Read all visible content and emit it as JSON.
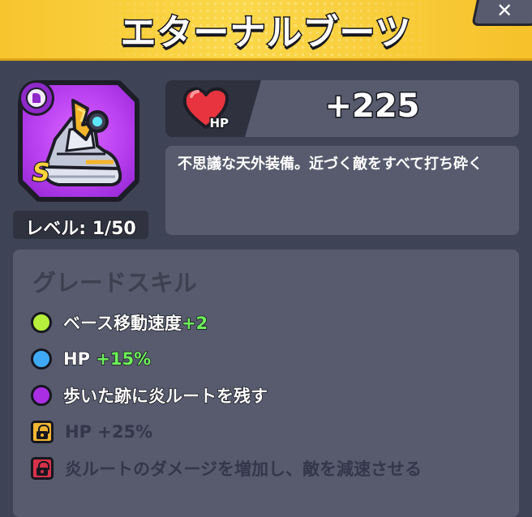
{
  "header": {
    "title": "エターナルブーツ",
    "close_icon": "close-x-icon"
  },
  "item": {
    "grade": "S",
    "rarity_icon": "boot-rarity-icon",
    "item_icon": "eternal-boots-icon",
    "frame_color": "#b93ff0",
    "level_label": "レベル: 1/50"
  },
  "stat": {
    "icon": "heart-hp-icon",
    "icon_label": "HP",
    "value": "+225"
  },
  "description": "不思議な天外装備。近づく敵をすべて打ち砕く",
  "skills": {
    "title": "グレードスキル",
    "items": [
      {
        "text": "ベース移動速度",
        "bonus": "+2",
        "dot": "green",
        "color": "#b6ef3c",
        "locked": false
      },
      {
        "text": "HP ",
        "bonus": "+15%",
        "dot": "blue",
        "color": "#3fa9f7",
        "locked": false
      },
      {
        "text": "歩いた跡に炎ルートを残す",
        "bonus": "",
        "dot": "purple",
        "color": "#a92ee3",
        "locked": false
      },
      {
        "text": "HP +25%",
        "bonus": "",
        "dot": "gold-lock",
        "color": "#f3b631",
        "locked": true
      },
      {
        "text": "炎ルートのダメージを増加し、敵を減速させる",
        "bonus": "",
        "dot": "red-lock",
        "color": "#d63249",
        "locked": true
      }
    ]
  }
}
